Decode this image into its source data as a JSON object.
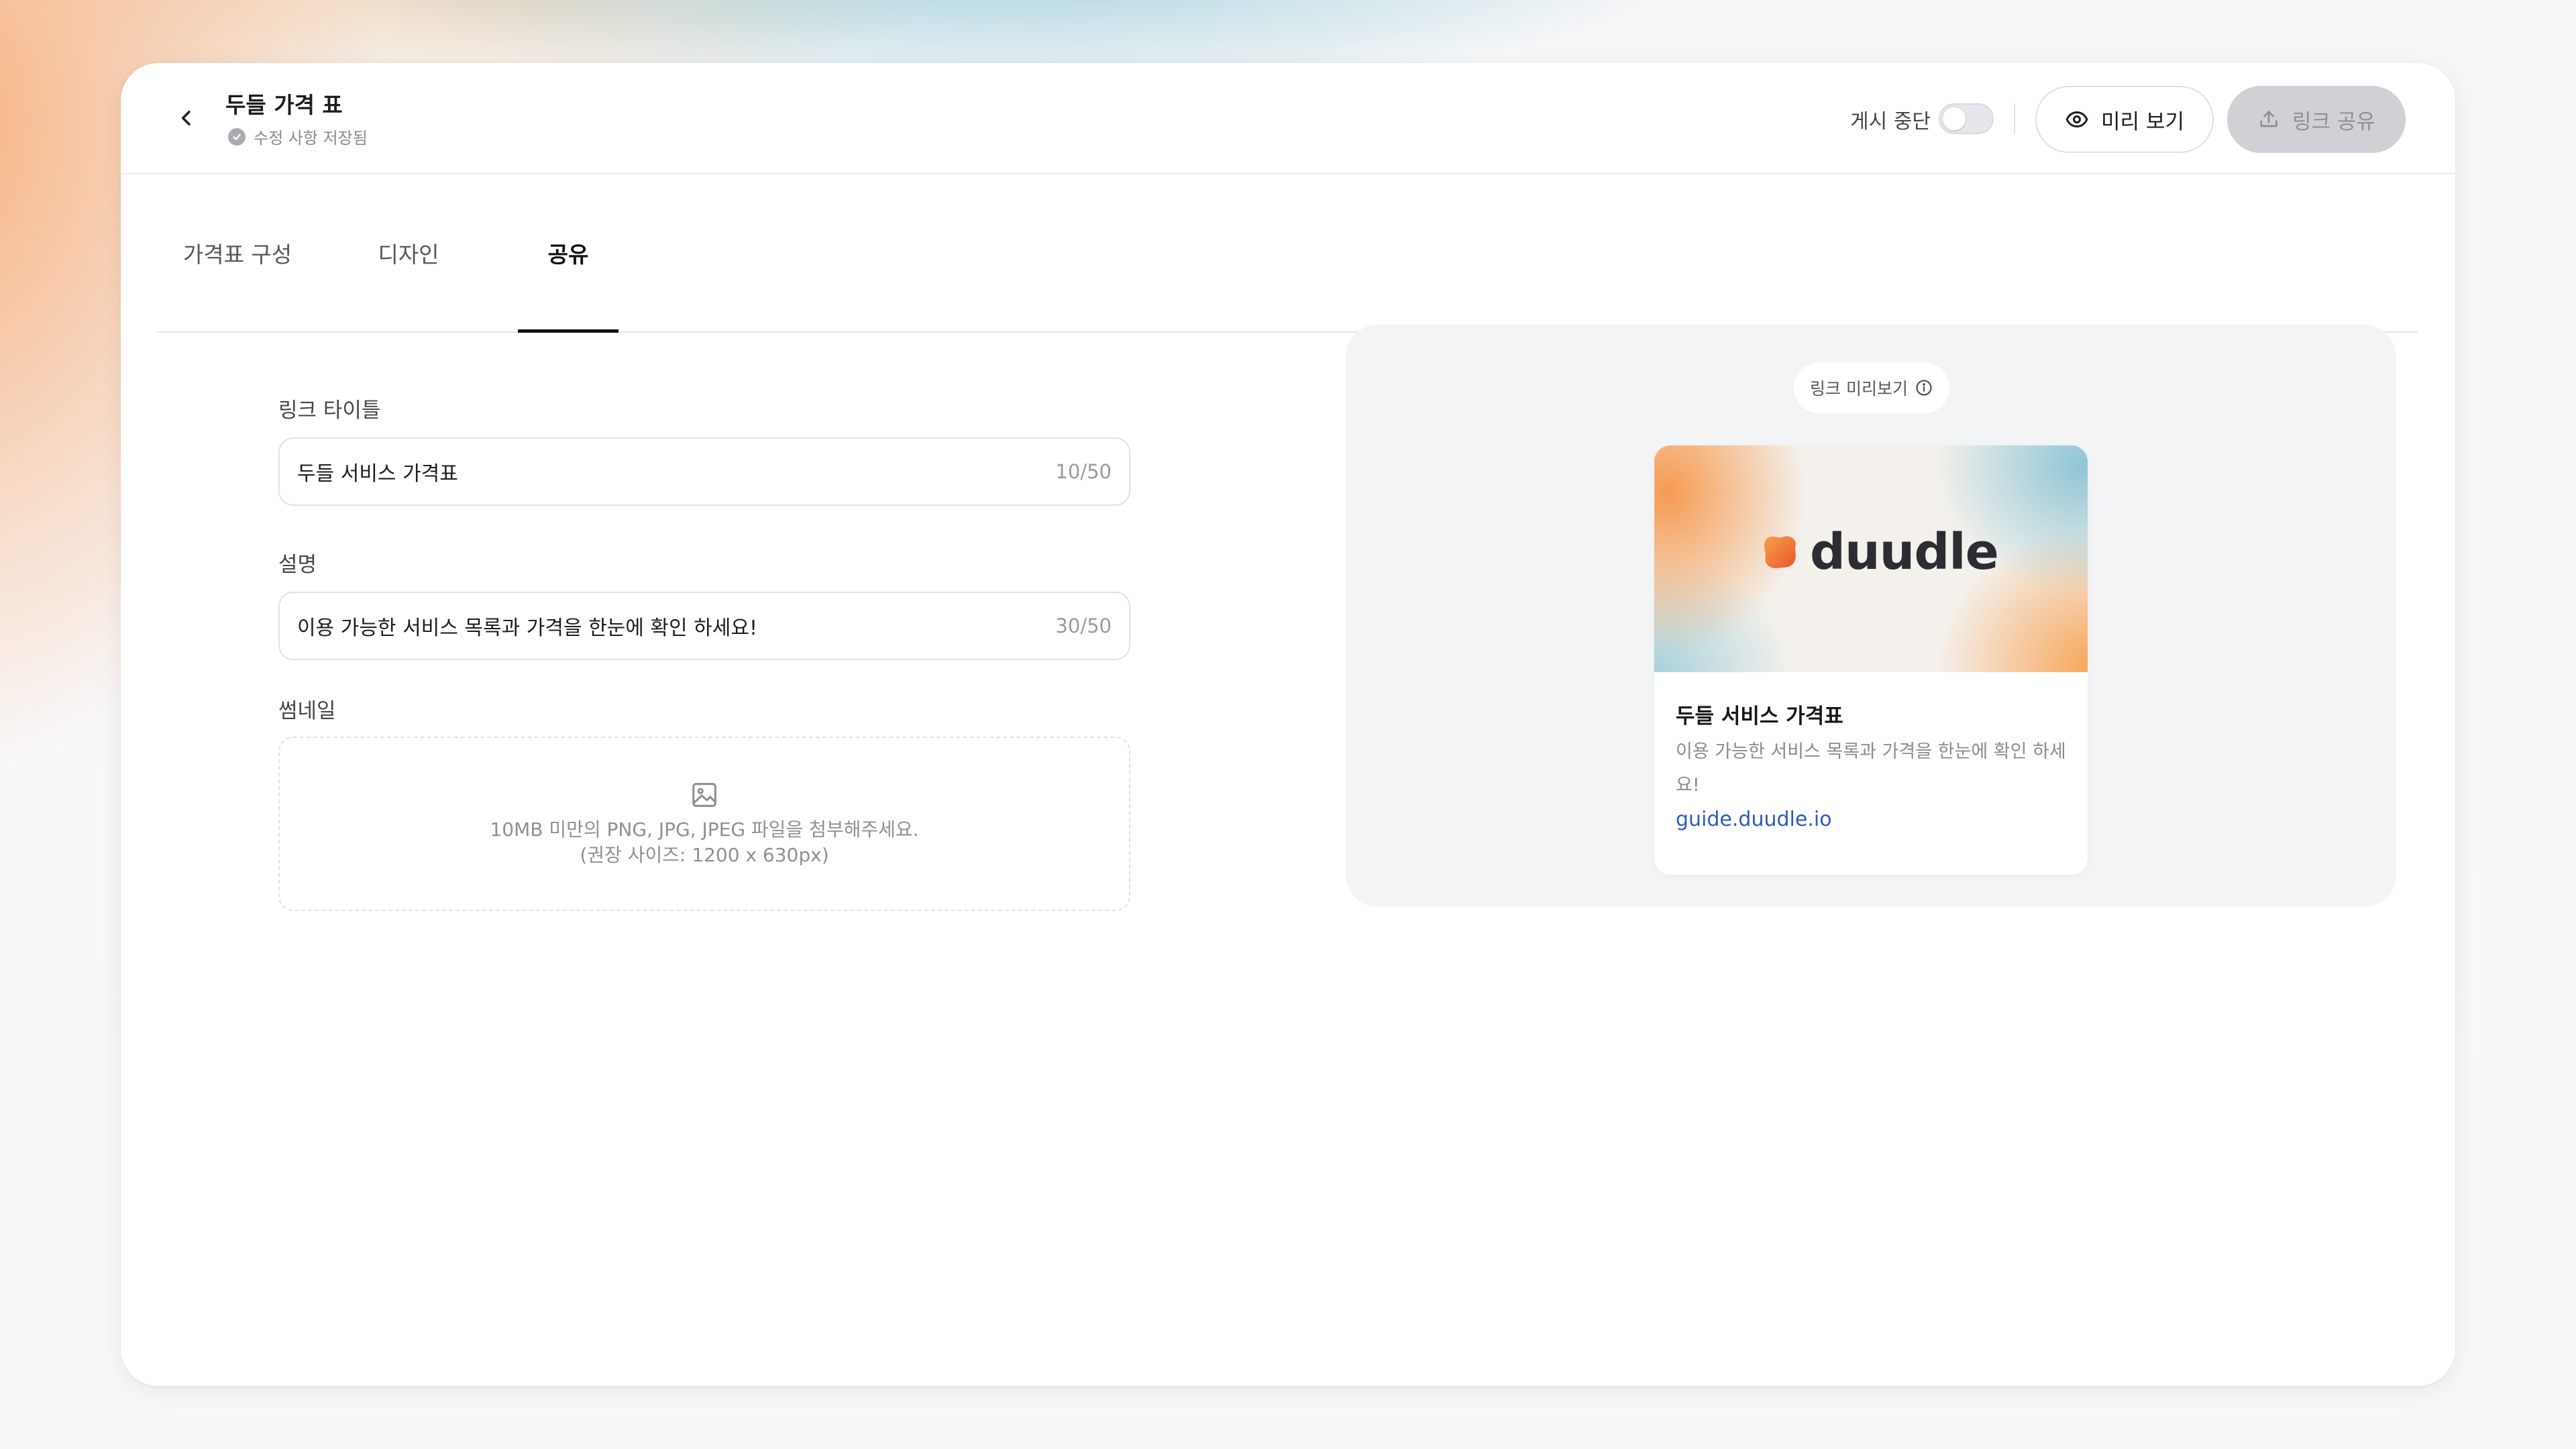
{
  "header": {
    "title": "두들 가격 표",
    "save_status": "수정 사항 저장됨",
    "pause_label": "게시 중단",
    "pause_toggle_on": false,
    "preview_button": "미리 보기",
    "share_button": "링크 공유"
  },
  "tabs": [
    {
      "label": "가격표 구성",
      "active": false
    },
    {
      "label": "디자인",
      "active": false
    },
    {
      "label": "공유",
      "active": true
    }
  ],
  "form": {
    "link_title": {
      "label": "링크 타이틀",
      "value": "두들 서비스 가격표",
      "counter": "10/50"
    },
    "description": {
      "label": "설명",
      "value": "이용 가능한 서비스 목록과 가격을 한눈에 확인 하세요!",
      "counter": "30/50"
    },
    "thumbnail": {
      "label": "썸네일",
      "hint_line1": "10MB 미만의 PNG, JPG, JPEG 파일을 첨부해주세요.",
      "hint_line2": "(권장 사이즈: 1200 x 630px)"
    }
  },
  "preview": {
    "chip_label": "링크 미리보기",
    "card": {
      "brand": "duudle",
      "title": "두들 서비스 가격표",
      "description": "이용 가능한 서비스 목록과 가격을 한눈에 확인 하세요!",
      "url": "guide.duudle.io"
    }
  },
  "colors": {
    "accent_link": "#2a5bbf",
    "brand_orange": "#f08a3c",
    "panel_bg": "#f3f4f6"
  }
}
